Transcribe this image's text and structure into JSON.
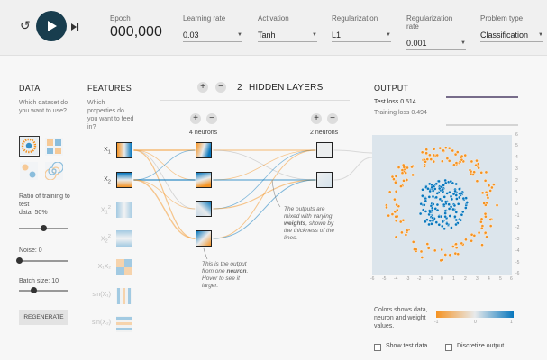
{
  "header": {
    "epoch_label": "Epoch",
    "epoch_value": "000,000",
    "controls": [
      {
        "key": "learning_rate",
        "label": "Learning rate",
        "value": "0.03"
      },
      {
        "key": "activation",
        "label": "Activation",
        "value": "Tanh"
      },
      {
        "key": "regularization",
        "label": "Regularization",
        "value": "L1"
      },
      {
        "key": "regularization_rate",
        "label": "Regularization rate",
        "value": "0.001"
      },
      {
        "key": "problem_type",
        "label": "Problem type",
        "value": "Classification"
      }
    ]
  },
  "data_panel": {
    "title": "DATA",
    "question": "Which dataset do you want to use?",
    "ratio_label": "Ratio of training to test",
    "ratio_data_label": "data:",
    "ratio_value": "50%",
    "ratio_fraction": 0.5,
    "noise_label": "Noise:",
    "noise_value": "0",
    "noise_fraction": 0.0,
    "batch_label": "Batch size:",
    "batch_value": "10",
    "batch_fraction": 0.3,
    "regenerate_label": "REGENERATE"
  },
  "features_panel": {
    "title": "FEATURES",
    "question": "Which properties do you want to feed in?",
    "features": [
      {
        "base": "X",
        "sub": "1",
        "sup": "",
        "active": true
      },
      {
        "base": "X",
        "sub": "2",
        "sup": "",
        "active": true
      },
      {
        "base": "X",
        "sub": "1",
        "sup": "2",
        "active": false
      },
      {
        "base": "X",
        "sub": "2",
        "sup": "2",
        "active": false
      },
      {
        "base": "X₁X₂",
        "sub": "",
        "sup": "",
        "active": false
      },
      {
        "base": "sin(X₁)",
        "sub": "",
        "sup": "",
        "active": false
      },
      {
        "base": "sin(X₂)",
        "sub": "",
        "sup": "",
        "active": false
      }
    ]
  },
  "network": {
    "layer_count": "2",
    "hidden_layers_label": "HIDDEN LAYERS",
    "layers": [
      {
        "neurons_label": "4 neurons"
      },
      {
        "neurons_label": "2 neurons"
      }
    ],
    "note_neuron_pre": "This is the output from one",
    "note_neuron_bold": "neuron",
    "note_neuron_post": ". Hover to see it larger.",
    "note_weights_pre": "The outputs are mixed with varying",
    "note_weights_bold": "weights",
    "note_weights_post": ", shown by the thickness of the lines."
  },
  "output_panel": {
    "title": "OUTPUT",
    "test_loss_label": "Test loss",
    "test_loss_value": "0.514",
    "training_loss_label": "Training loss",
    "training_loss_value": "0.494",
    "x_ticks": [
      "-6",
      "-5",
      "-4",
      "-3",
      "-2",
      "-1",
      "0",
      "1",
      "2",
      "3",
      "4",
      "5",
      "6"
    ],
    "y_ticks": [
      "6",
      "5",
      "4",
      "3",
      "2",
      "1",
      "0",
      "-1",
      "-2",
      "-3",
      "-4",
      "-5",
      "-6"
    ],
    "legend_text": "Colors shows data, neuron and weight values.",
    "legend_min": "-1",
    "legend_mid": "0",
    "legend_max": "1",
    "show_test_label": "Show test data",
    "discretize_label": "Discretize output"
  },
  "colors": {
    "orange": "#f59322",
    "blue": "#0877bd",
    "dark": "#183d4e"
  }
}
